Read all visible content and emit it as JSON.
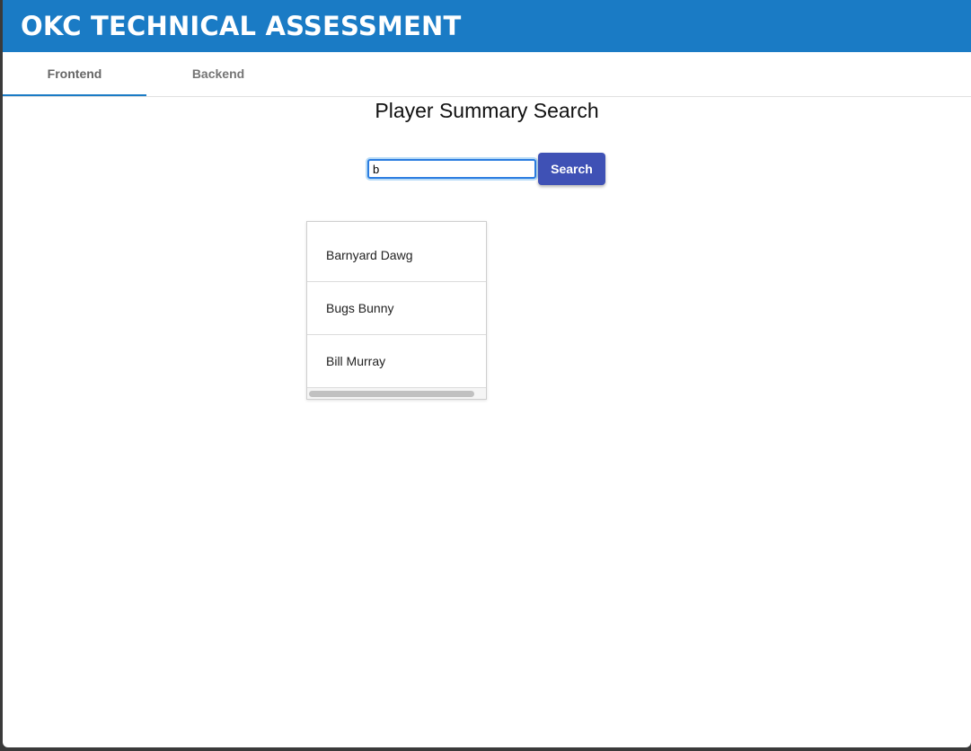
{
  "app": {
    "title": "OKC TECHNICAL ASSESSMENT"
  },
  "tabs": [
    {
      "label": "Frontend",
      "active": true
    },
    {
      "label": "Backend",
      "active": false
    }
  ],
  "colors": {
    "app_bar": "#1a7bc5",
    "tab_indicator": "#1a7bc5",
    "search_button": "#3f51b5"
  },
  "main": {
    "heading": "Player Summary Search",
    "search": {
      "value": "b",
      "button_label": "Search"
    },
    "results": [
      "Barnyard Dawg",
      "Bugs Bunny",
      "Bill Murray"
    ]
  }
}
